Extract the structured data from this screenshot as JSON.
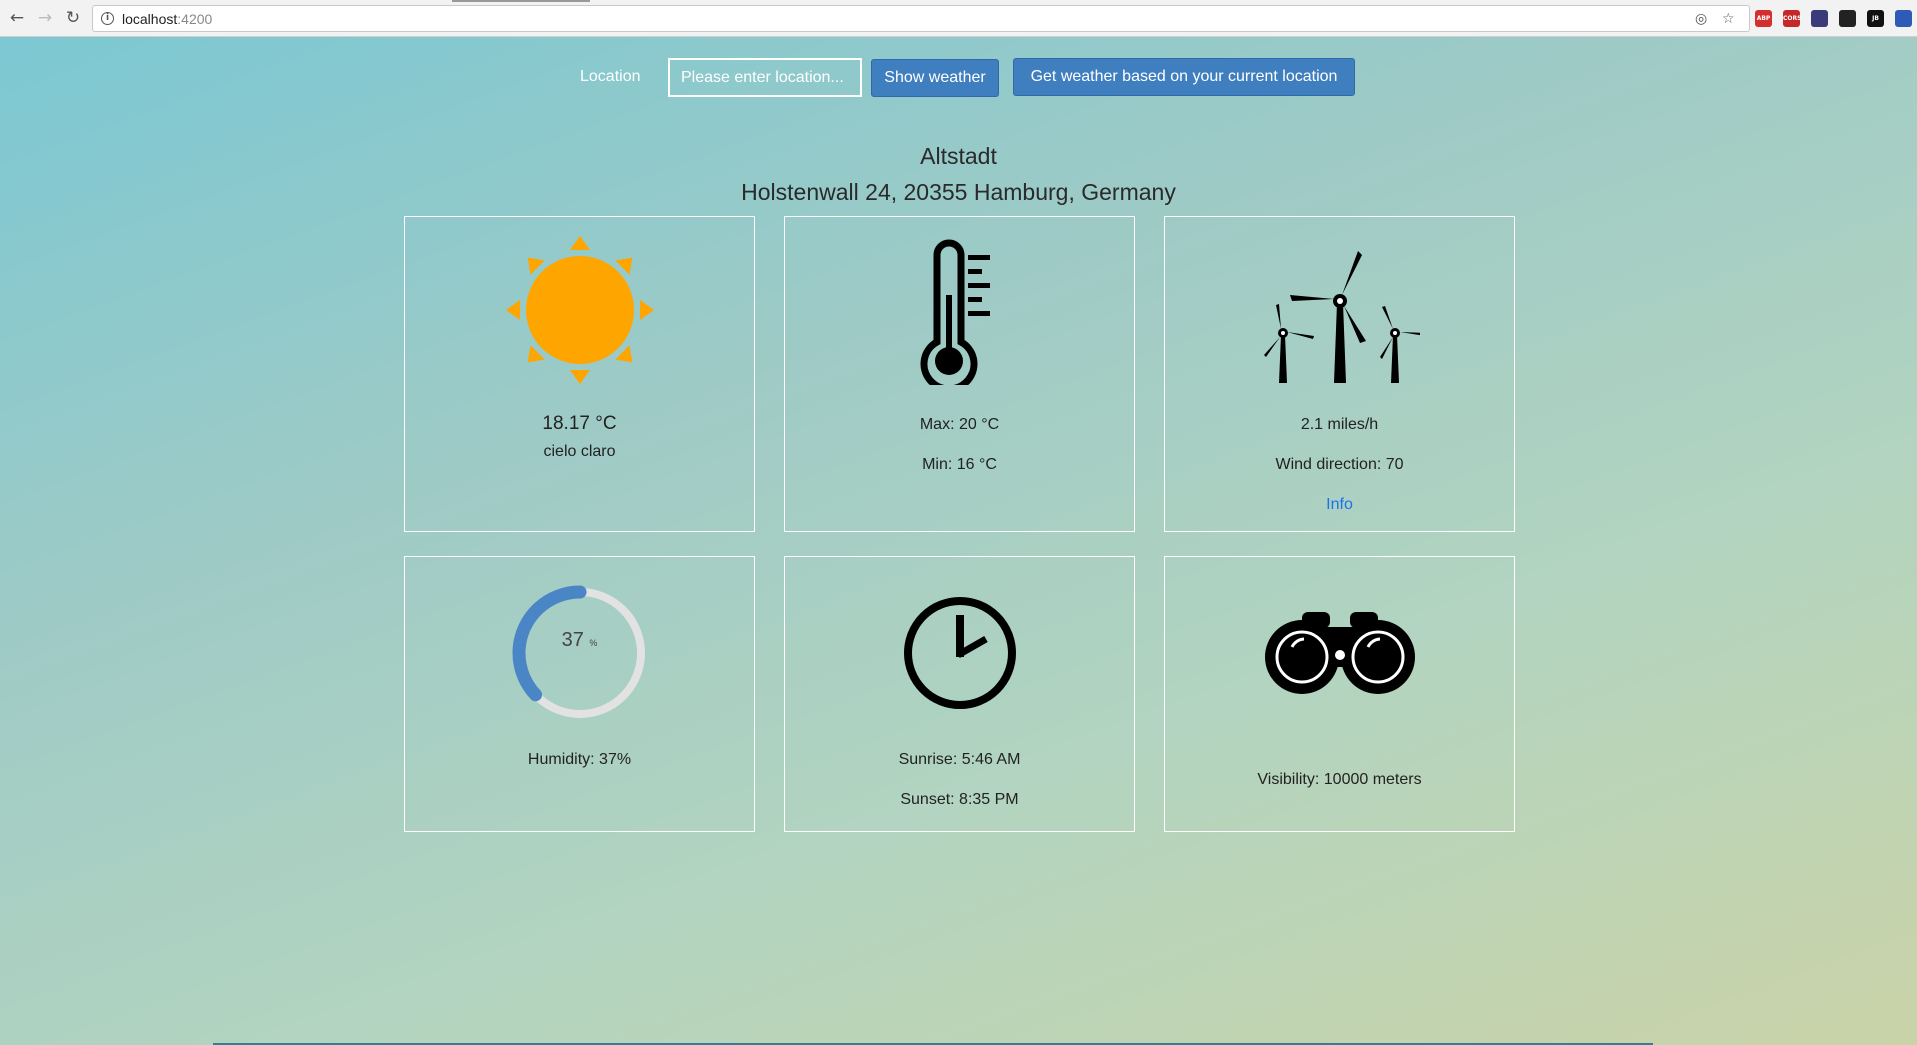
{
  "browser": {
    "url_host": "localhost",
    "url_port": ":4200",
    "extensions": [
      {
        "icon": "adblock-icon",
        "text": "ABP",
        "color": "#d32f2f"
      },
      {
        "icon": "cors-icon",
        "text": "CORS",
        "color": "#c62828"
      },
      {
        "icon": "privacy-icon",
        "text": "",
        "color": "#3b3b7a"
      },
      {
        "icon": "pocket-icon",
        "text": "",
        "color": "#222"
      },
      {
        "icon": "jb-icon",
        "text": "JB",
        "color": "#111"
      },
      {
        "icon": "translate-icon",
        "text": "",
        "color": "#2f5bb7"
      },
      {
        "icon": "notification-icon",
        "text": "!",
        "color": "#f4a300"
      }
    ]
  },
  "search": {
    "label": "Location",
    "placeholder": "Please enter location...",
    "show_button": "Show weather",
    "geo_button": "Get weather based on your current location"
  },
  "place": {
    "name": "Altstadt",
    "address": "Holstenwall 24, 20355 Hamburg, Germany"
  },
  "cards": {
    "current": {
      "temperature": "18.17 °C",
      "description": "cielo claro",
      "icon": "sun-icon",
      "icon_color": "#ffa500"
    },
    "temperature": {
      "max": "Max: 20 °C",
      "min": "Min: 16 °C",
      "icon": "thermometer-icon"
    },
    "wind": {
      "speed": "2.1 miles/h",
      "direction": "Wind direction: 70",
      "info_link": "Info",
      "icon": "wind-turbine-icon"
    },
    "humidity": {
      "value": 37,
      "value_label": "37",
      "unit": "%",
      "label": "Humidity: 37%",
      "accent": "#4a86c5"
    },
    "sun": {
      "sunrise": "Sunrise: 5:46 AM",
      "sunset": "Sunset: 8:35 PM",
      "icon": "clock-icon"
    },
    "visibility": {
      "label": "Visibility: 10000 meters",
      "icon": "binoculars-icon"
    }
  }
}
